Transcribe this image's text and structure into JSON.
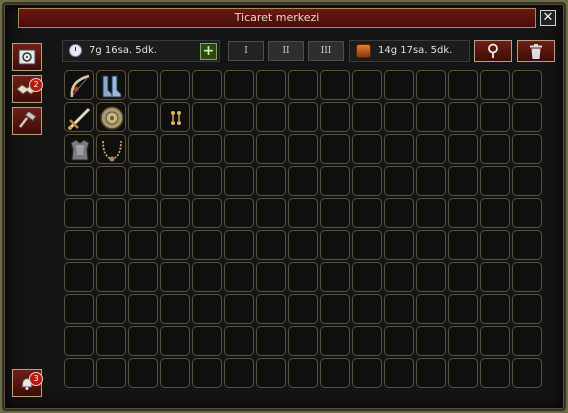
{
  "window": {
    "title": "Ticaret merkezi",
    "close_label": "✕"
  },
  "sidebar": {
    "buttons": [
      {
        "name": "storage",
        "icon": "safe-icon",
        "badge": null
      },
      {
        "name": "trade",
        "icon": "handshake-icon",
        "badge": "2"
      },
      {
        "name": "auction",
        "icon": "gavel-icon",
        "badge": null
      }
    ],
    "notifications": {
      "icon": "bell-icon",
      "badge": "3"
    }
  },
  "toolbar": {
    "time_left": "7g 16sa. 5dk.",
    "add_label": "+",
    "tabs": [
      "I",
      "II",
      "III"
    ],
    "active_tab": 0,
    "chest_time": "14g 17sa. 5dk.",
    "location_icon": "map-pin-icon",
    "trash_icon": "trash-icon"
  },
  "inventory": {
    "columns": 15,
    "rows": 10,
    "items": [
      {
        "row": 0,
        "col": 0,
        "icon": "bow-icon"
      },
      {
        "row": 0,
        "col": 1,
        "icon": "boots-icon"
      },
      {
        "row": 1,
        "col": 0,
        "icon": "sword-icon"
      },
      {
        "row": 1,
        "col": 1,
        "icon": "shield-icon"
      },
      {
        "row": 1,
        "col": 3,
        "icon": "earrings-icon"
      },
      {
        "row": 2,
        "col": 0,
        "icon": "armor-icon"
      },
      {
        "row": 2,
        "col": 1,
        "icon": "necklace-icon"
      }
    ]
  }
}
